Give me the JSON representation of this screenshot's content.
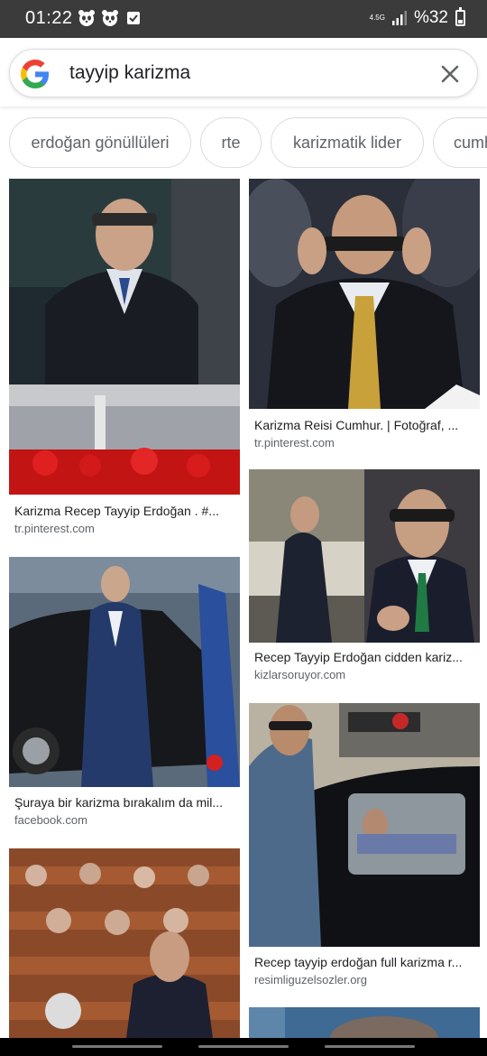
{
  "status_bar": {
    "time": "01:22",
    "network": "4.5G",
    "battery_text": "%32",
    "battery_level": 0.32
  },
  "search": {
    "query": "tayyip karizma"
  },
  "chips": [
    "erdoğan gönüllüleri",
    "rte",
    "karizmatik lider",
    "cumh"
  ],
  "results": [
    {
      "caption": "Karizma Recep Tayyip Erdoğan . #...",
      "source": "tr.pinterest.com"
    },
    {
      "caption": "Karizma Reisi Cumhur. | Fotoğraf, ...",
      "source": "tr.pinterest.com"
    },
    {
      "caption": "Recep Tayyip Erdoğan cidden kariz...",
      "source": "kizlarsoruyor.com"
    },
    {
      "caption": "Şuraya bir karizma bırakalım da mil...",
      "source": "facebook.com"
    },
    {
      "caption": "Recep tayyip erdoğan full karizma r...",
      "source": "resimliguzelsozler.org"
    },
    {
      "caption": "",
      "source": ""
    },
    {
      "caption": "",
      "source": ""
    }
  ]
}
